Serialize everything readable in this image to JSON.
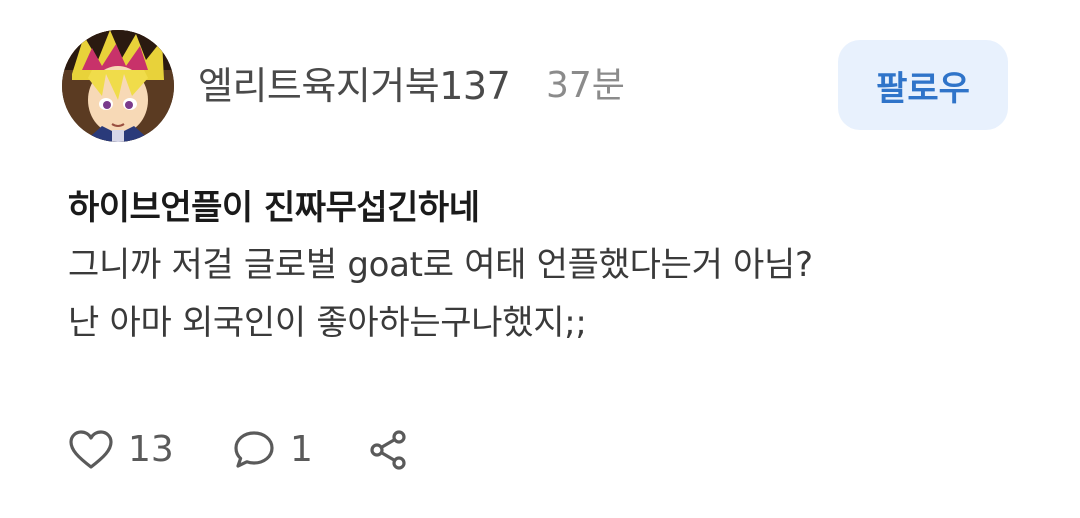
{
  "author": {
    "username": "엘리트육지거북137",
    "avatar_icon": "avatar-anime-character",
    "timestamp": "37분"
  },
  "follow_button": {
    "label": "팔로우",
    "bg_color": "#e8f1fd",
    "text_color": "#2f74c9"
  },
  "post": {
    "title": "하이브언플이 진짜무섭긴하네",
    "lines": [
      "그니까 저걸 글로벌 goat로 여태 언플했다는거 아님?",
      "난 아마 외국인이 좋아하는구나했지;;"
    ]
  },
  "actions": {
    "like": {
      "icon": "heart-icon",
      "count": "13"
    },
    "comment": {
      "icon": "comment-icon",
      "count": "1"
    },
    "share": {
      "icon": "share-icon"
    }
  }
}
